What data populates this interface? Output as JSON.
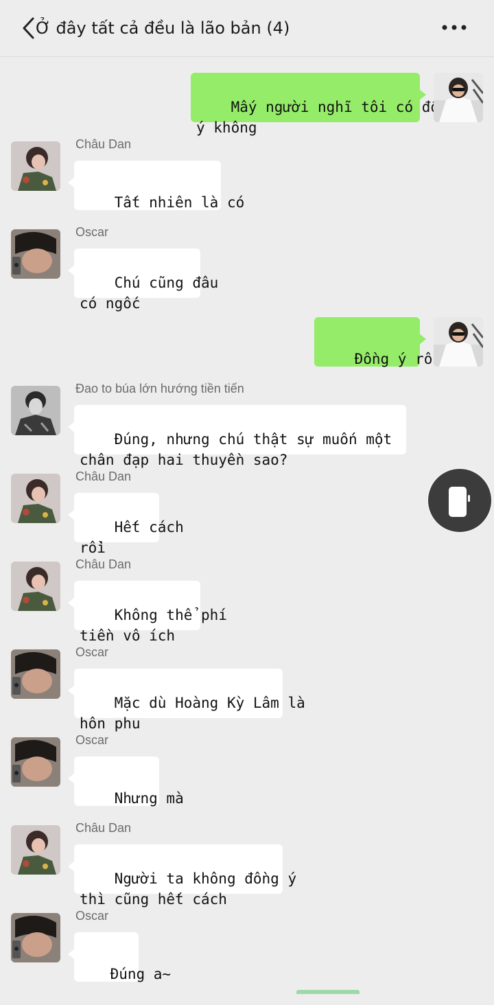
{
  "header": {
    "title": "Ở đây tất cả đều là lão bản (4)"
  },
  "messages": [
    {
      "side": "right",
      "sender": "",
      "avatar": "avatar-self",
      "text": "Mấy người nghĩ tôi có đồng\ný không"
    },
    {
      "side": "left",
      "sender": "Châu Dan",
      "avatar": "avatar-chau-dan",
      "text": "Tất nhiên là có"
    },
    {
      "side": "left",
      "sender": "Oscar",
      "avatar": "avatar-oscar",
      "text": "Chú cũng đâu\ncó ngốc"
    },
    {
      "side": "right",
      "sender": "",
      "avatar": "avatar-self",
      "text": "Đồng ý rồi"
    },
    {
      "side": "left",
      "sender": "Đao to búa lớn hướng tiền tiến",
      "avatar": "avatar-dao-to",
      "text": "Đúng, nhưng chú thật sự muốn một\nchân đạp hai thuyền sao?"
    },
    {
      "side": "left",
      "sender": "Châu Dan",
      "avatar": "avatar-chau-dan",
      "text": "Hết cách\nrồi"
    },
    {
      "side": "left",
      "sender": "Châu Dan",
      "avatar": "avatar-chau-dan",
      "text": "Không thể phí\ntiền vô ích"
    },
    {
      "side": "left",
      "sender": "Oscar",
      "avatar": "avatar-oscar",
      "text": "Mặc dù Hoàng Kỳ Lâm là\nhôn phu"
    },
    {
      "side": "left",
      "sender": "Oscar",
      "avatar": "avatar-oscar",
      "text": "Nhưng mà"
    },
    {
      "side": "left",
      "sender": "Châu Dan",
      "avatar": "avatar-chau-dan",
      "text": "Người ta không đồng ý\nthì cũng hết cách"
    },
    {
      "side": "left",
      "sender": "Oscar",
      "avatar": "avatar-oscar",
      "text": "Đúng a~"
    }
  ],
  "colors": {
    "background": "#ededed",
    "bubble_out": "#95ec69",
    "bubble_in": "#ffffff",
    "float_button": "#3c3c3c"
  },
  "icons": {
    "back": "chevron-left-icon",
    "more": "more-dots-icon",
    "float": "phone-icon"
  }
}
